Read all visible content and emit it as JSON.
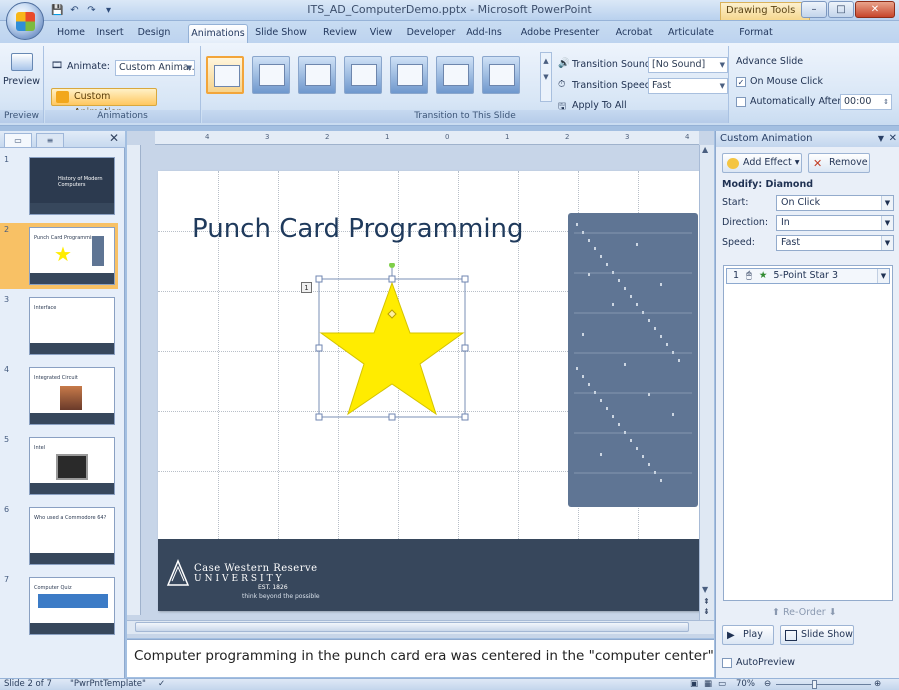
{
  "window": {
    "title": "ITS_AD_ComputerDemo.pptx - Microsoft PowerPoint",
    "context_tab_label": "Drawing Tools"
  },
  "tabs": [
    "Home",
    "Insert",
    "Design",
    "Animations",
    "Slide Show",
    "Review",
    "View",
    "Developer",
    "Add-Ins",
    "Adobe Presenter",
    "Acrobat",
    "Articulate",
    "Format"
  ],
  "active_tab": "Animations",
  "ribbon": {
    "preview_group": {
      "button": "Preview",
      "label": "Preview"
    },
    "animations_group": {
      "animate_label": "Animate:",
      "animate_value": "Custom Anima...",
      "custom_animation": "Custom Animation",
      "label": "Animations"
    },
    "transition_group": {
      "sound_label": "Transition Sound:",
      "sound_value": "[No Sound]",
      "speed_label": "Transition Speed:",
      "speed_value": "Fast",
      "apply_all": "Apply To All",
      "label": "Transition to This Slide"
    },
    "advance_group": {
      "title": "Advance Slide",
      "on_mouse_click": "On Mouse Click",
      "auto_after": "Automatically After:",
      "auto_value": "00:00"
    }
  },
  "slides_pane": {
    "slides": [
      {
        "num": "1",
        "title": "History of Modern Computers"
      },
      {
        "num": "2",
        "title": "Punch Card Programming"
      },
      {
        "num": "3",
        "title": "Interface"
      },
      {
        "num": "4",
        "title": "Integrated Circuit"
      },
      {
        "num": "5",
        "title": "Intel"
      },
      {
        "num": "6",
        "title": "Who used a Commodore 64?"
      },
      {
        "num": "7",
        "title": "Computer Quiz"
      }
    ]
  },
  "slide": {
    "title": "Punch Card Programming",
    "anim_tag": "1",
    "logo_line1": "Case Western Reserve",
    "logo_line2": "UNIVERSITY",
    "logo_est": "EST. 1826",
    "logo_tagline": "think beyond the possible"
  },
  "notes": {
    "text": "Computer programming in the punch card era was centered in the \"computer center\"."
  },
  "task_pane": {
    "title": "Custom Animation",
    "add_effect": "Add Effect",
    "remove": "Remove",
    "modify": "Modify: Diamond",
    "start_label": "Start:",
    "start_value": "On Click",
    "direction_label": "Direction:",
    "direction_value": "In",
    "speed_label": "Speed:",
    "speed_value": "Fast",
    "effect_item": "5-Point Star 3",
    "effect_num": "1",
    "reorder": "Re-Order",
    "play": "Play",
    "slide_show": "Slide Show",
    "autopreview": "AutoPreview"
  },
  "statusbar": {
    "slide_info": "Slide 2 of 7",
    "template": "\"PwrPntTemplate\"",
    "zoom": "70%"
  },
  "colors": {
    "accent": "#f8c165",
    "footer": "#37475c",
    "star": "#ffec00",
    "title": "#1f3a5c"
  }
}
